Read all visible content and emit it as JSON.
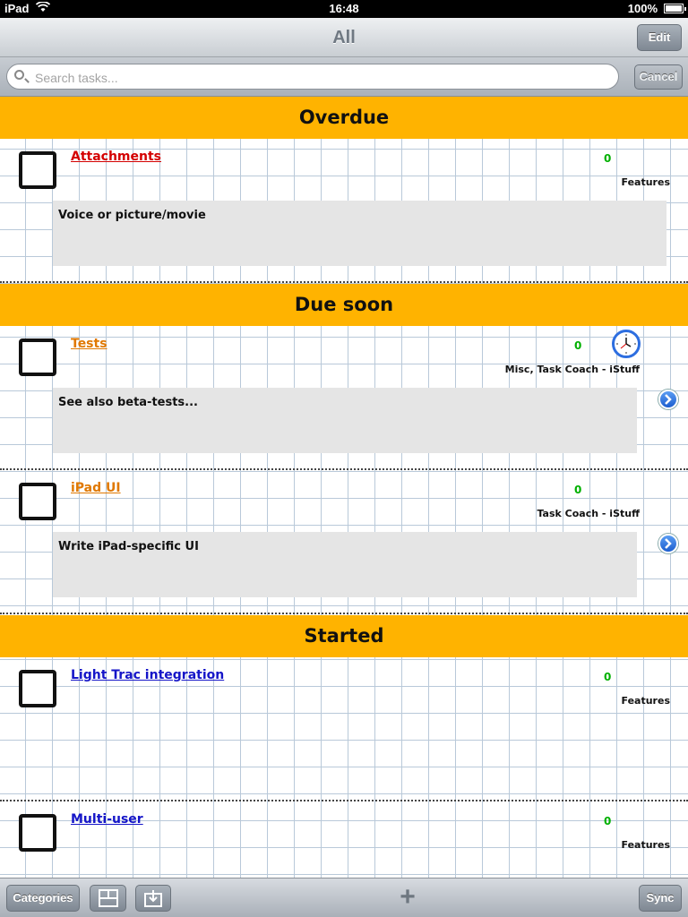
{
  "status_bar": {
    "carrier": "iPad",
    "time": "16:48",
    "battery": "100%"
  },
  "nav": {
    "title": "All",
    "edit_label": "Edit"
  },
  "search": {
    "placeholder": "Search tasks...",
    "cancel_label": "Cancel"
  },
  "sections": [
    {
      "title": "Overdue",
      "tasks": [
        {
          "name": "Attachments",
          "color": "#d40000",
          "count": "0",
          "categories": "Features",
          "note": "Voice or picture/movie"
        }
      ]
    },
    {
      "title": "Due soon",
      "tasks": [
        {
          "name": "Tests",
          "color": "#e07800",
          "count": "0",
          "categories": "Misc, Task Coach - iStuff",
          "note": "See also beta-tests...",
          "icon": "clock-icon"
        },
        {
          "name": "iPad UI",
          "color": "#e07800",
          "count": "0",
          "categories": "Task Coach - iStuff",
          "note": "Write iPad-specific UI"
        }
      ]
    },
    {
      "title": "Started",
      "tasks": [
        {
          "name": "Light Trac integration",
          "color": "#1515c8",
          "count": "0",
          "categories": "Features"
        },
        {
          "name": "Multi-user",
          "color": "#1515c8",
          "count": "0",
          "categories": "Features"
        }
      ]
    }
  ],
  "toolbar": {
    "categories_label": "Categories",
    "add_label": "+",
    "sync_label": "Sync"
  },
  "colors": {
    "section_header": "#ffb300",
    "count": "#00b000",
    "accent": "#2d6ee0"
  }
}
